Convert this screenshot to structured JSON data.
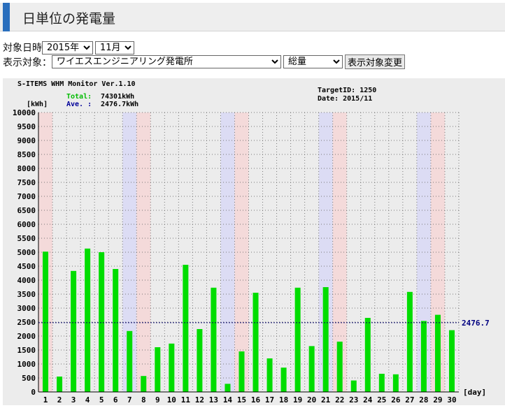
{
  "page_title": "日単位の発電量",
  "filter": {
    "date_label": "対象日時",
    "year_value": "2015年",
    "month_value": "11月",
    "target_label": "表示対象：",
    "target_value": "ワイエスエンジニアリング発電所",
    "scope_value": "総量",
    "change_button": "表示対象変更"
  },
  "colors": {
    "bar": "#00dd00",
    "saturday_band": "#dcdcf4",
    "sunday_band": "#f4dada",
    "plot_bg": "#ececec",
    "total_label": "#00bb00",
    "ave_label": "#000099",
    "ave_value": "#000080"
  },
  "chart_data": {
    "type": "bar",
    "header": "S-ITEMS WHM Monitor Ver.1.10",
    "total_label": "Total:",
    "total_value": "74301kWh",
    "ave_label": "Ave. :",
    "ave_value": "2476.7kWh",
    "target_id": "TargetID: 1250",
    "date": "Date: 2015/11",
    "ylabel": "[kWh]",
    "xlabel": "[day]",
    "ylim": [
      0,
      10000
    ],
    "ytick_step": 500,
    "average": 2476.7,
    "average_label": "2476.7",
    "grid": true,
    "categories": [
      "1",
      "2",
      "3",
      "4",
      "5",
      "6",
      "7",
      "8",
      "9",
      "10",
      "11",
      "12",
      "13",
      "14",
      "15",
      "16",
      "17",
      "18",
      "19",
      "20",
      "21",
      "22",
      "23",
      "24",
      "25",
      "26",
      "27",
      "28",
      "29",
      "30"
    ],
    "values": [
      5020,
      550,
      4330,
      5130,
      5000,
      4400,
      2180,
      570,
      1600,
      1730,
      4550,
      2250,
      3730,
      290,
      1450,
      3550,
      1200,
      870,
      3730,
      1640,
      3750,
      1800,
      410,
      2650,
      650,
      630,
      3580,
      2540,
      2760,
      2210
    ],
    "saturdays": [
      "7",
      "14",
      "21",
      "28"
    ],
    "sundays": [
      "1",
      "8",
      "15",
      "22",
      "29"
    ]
  }
}
